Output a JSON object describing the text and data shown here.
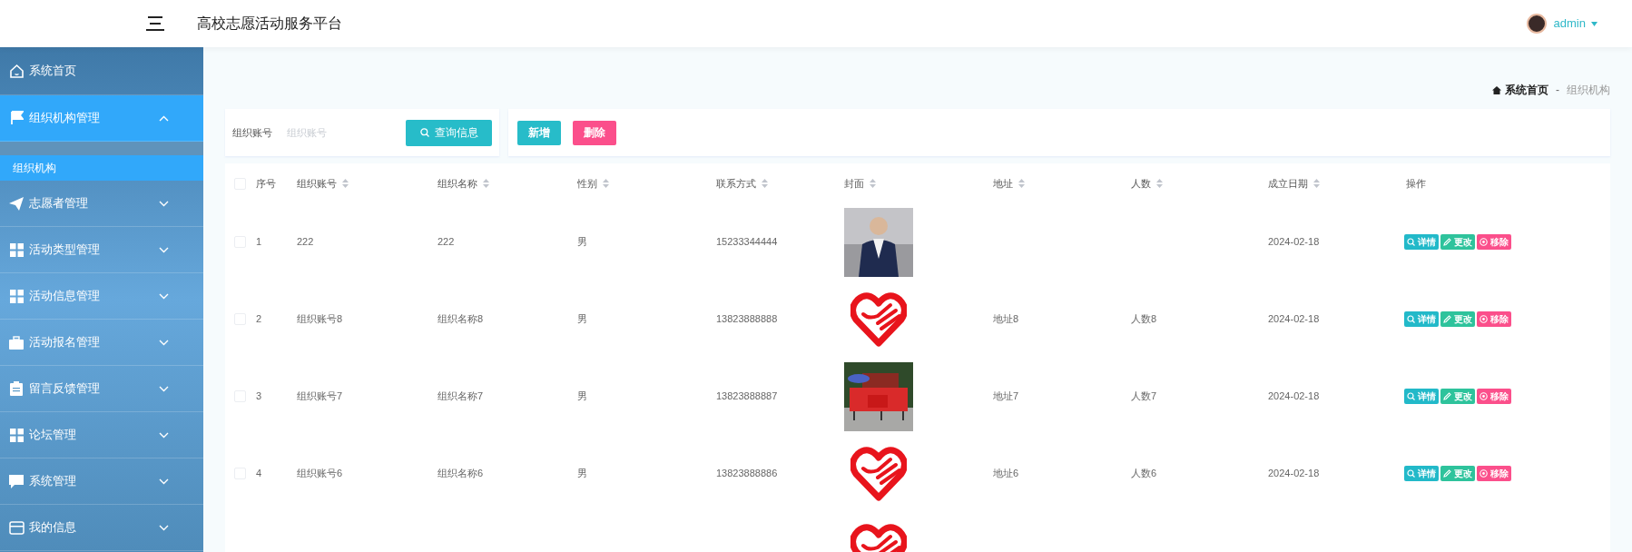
{
  "header": {
    "title": "高校志愿活动服务平台",
    "user": "admin"
  },
  "sidebar": {
    "items": [
      {
        "label": "系统首页",
        "kind": "link",
        "selected": false
      },
      {
        "label": "组织机构管理",
        "kind": "menu",
        "selected": true,
        "expanded": true,
        "children": [
          {
            "label": "组织机构",
            "selected": true
          }
        ]
      },
      {
        "label": "志愿者管理",
        "kind": "menu",
        "selected": false,
        "expanded": false
      },
      {
        "label": "活动类型管理",
        "kind": "menu",
        "selected": false,
        "expanded": false
      },
      {
        "label": "活动信息管理",
        "kind": "menu",
        "selected": false,
        "expanded": false
      },
      {
        "label": "活动报名管理",
        "kind": "menu",
        "selected": false,
        "expanded": false
      },
      {
        "label": "留言反馈管理",
        "kind": "menu",
        "selected": false,
        "expanded": false
      },
      {
        "label": "论坛管理",
        "kind": "menu",
        "selected": false,
        "expanded": false
      },
      {
        "label": "系统管理",
        "kind": "menu",
        "selected": false,
        "expanded": false
      },
      {
        "label": "我的信息",
        "kind": "menu",
        "selected": false,
        "expanded": false
      }
    ]
  },
  "breadcrumb": {
    "items": [
      {
        "label": "系统首页",
        "kind": "home"
      },
      {
        "label": "组织机构",
        "kind": "current"
      }
    ],
    "separator": "-"
  },
  "search": {
    "label": "组织账号",
    "placeholder": "组织账号",
    "button": "查询信息"
  },
  "toolbar": [
    {
      "label": "新增",
      "kind": "add"
    },
    {
      "label": "删除",
      "kind": "delete"
    }
  ],
  "table": {
    "select_all": {
      "checked": false
    },
    "columns": [
      {
        "label": "序号",
        "sortable": false
      },
      {
        "label": "组织账号",
        "sortable": true
      },
      {
        "label": "组织名称",
        "sortable": true
      },
      {
        "label": "性别",
        "sortable": true
      },
      {
        "label": "联系方式",
        "sortable": true
      },
      {
        "label": "封面",
        "sortable": true
      },
      {
        "label": "地址",
        "sortable": true
      },
      {
        "label": "人数",
        "sortable": true
      },
      {
        "label": "成立日期",
        "sortable": true
      },
      {
        "label": "操作",
        "sortable": false
      }
    ],
    "rows": [
      {
        "checked": false,
        "index": "1",
        "account": "222",
        "name": "222",
        "gender": "男",
        "phone": "15233344444",
        "date": "2024-02-18",
        "actions": [
          {
            "label": "详情",
            "kind": "view"
          },
          {
            "label": "更改",
            "kind": "edit"
          },
          {
            "label": "移除",
            "kind": "remove"
          }
        ]
      },
      {
        "checked": false,
        "index": "2",
        "account": "组织账号8",
        "name": "组织名称8",
        "gender": "男",
        "phone": "13823888888",
        "cover": {
          "kind": "logo"
        },
        "address": "地址8",
        "people": "人数8",
        "date": "2024-02-18",
        "actions": [
          {
            "label": "详情",
            "kind": "view"
          },
          {
            "label": "更改",
            "kind": "edit"
          },
          {
            "label": "移除",
            "kind": "remove"
          }
        ]
      },
      {
        "checked": false,
        "index": "3",
        "account": "组织账号7",
        "name": "组织名称7",
        "gender": "男",
        "phone": "13823888887",
        "address": "地址7",
        "people": "人数7",
        "date": "2024-02-18",
        "actions": [
          {
            "label": "详情",
            "kind": "view"
          },
          {
            "label": "更改",
            "kind": "edit"
          },
          {
            "label": "移除",
            "kind": "remove"
          }
        ]
      },
      {
        "checked": false,
        "index": "4",
        "account": "组织账号6",
        "name": "组织名称6",
        "gender": "男",
        "phone": "13823888886",
        "cover": {
          "kind": "logo"
        },
        "address": "地址6",
        "people": "人数6",
        "date": "2024-02-18",
        "actions": [
          {
            "label": "详情",
            "kind": "view"
          },
          {
            "label": "更改",
            "kind": "edit"
          },
          {
            "label": "移除",
            "kind": "remove"
          }
        ]
      },
      {
        "cover": {
          "kind": "logo"
        }
      }
    ]
  }
}
